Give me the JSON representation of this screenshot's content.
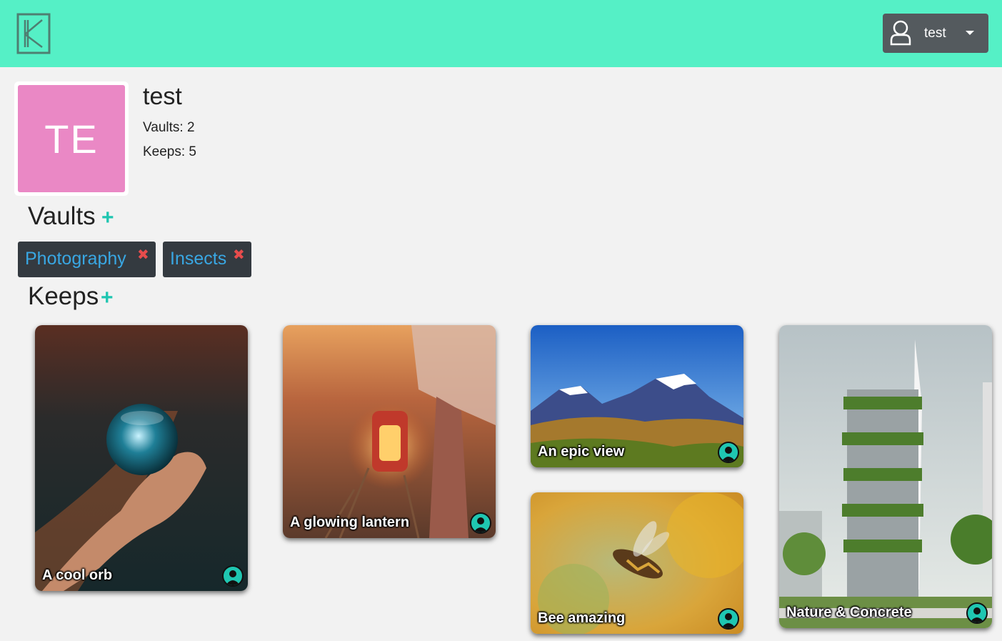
{
  "navbar": {
    "logo_letter": "K",
    "user_button": {
      "username": "test",
      "icon": "person-icon",
      "caret_icon": "caret-down-icon"
    },
    "bg_color": "#55f0c6"
  },
  "profile": {
    "initials": "TE",
    "name": "test",
    "vaults_label": "Vaults: 2",
    "keeps_label": "Keeps: 5",
    "avatar_color": "#ea88c5"
  },
  "vaults": {
    "title": "Vaults",
    "add_symbol": "+",
    "items": [
      {
        "name": "Photography",
        "remove_symbol": "✖"
      },
      {
        "name": "Insects",
        "remove_symbol": "✖"
      }
    ]
  },
  "keeps": {
    "title": "Keeps",
    "add_symbol": "+",
    "items": [
      {
        "title": "A cool orb",
        "image": "crystal-ball-in-hand"
      },
      {
        "title": "A glowing lantern",
        "image": "lantern-in-field"
      },
      {
        "title": "An epic view",
        "image": "snowy-mountains-valley"
      },
      {
        "title": "Bee amazing",
        "image": "bee-on-flower"
      },
      {
        "title": "Nature & Concrete",
        "image": "green-skyscraper"
      }
    ]
  },
  "colors": {
    "accent": "#1fc6b1",
    "vault_text": "#39a7e3",
    "remove": "#e74c4c",
    "chip_bg": "#343a40"
  }
}
